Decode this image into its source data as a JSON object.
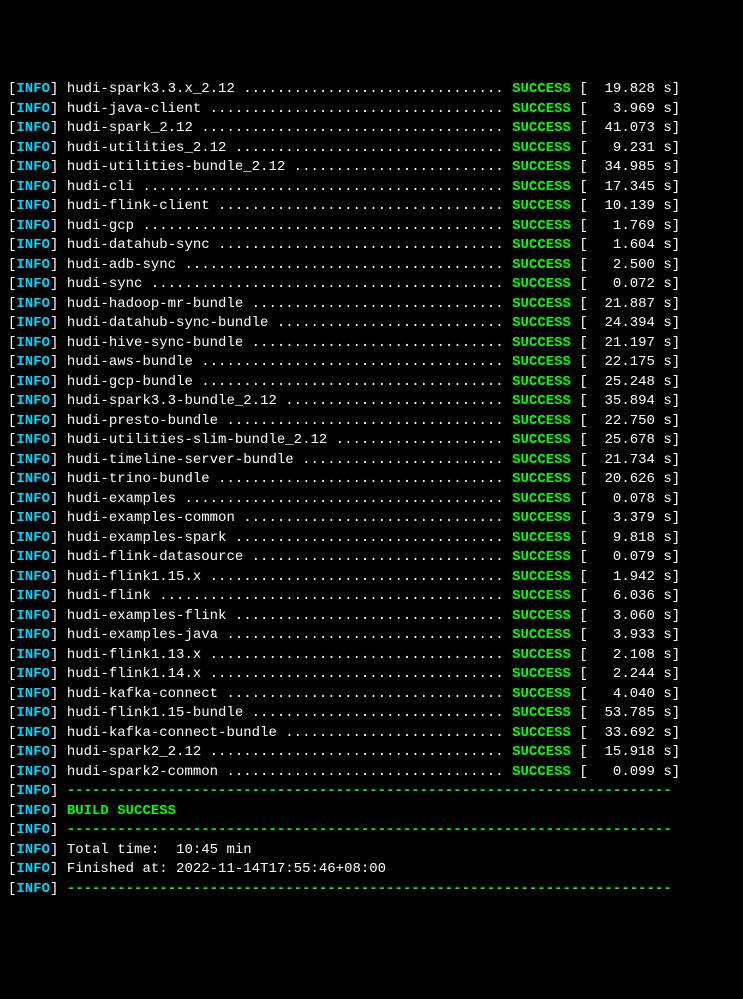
{
  "prefix": "INFO",
  "modules": [
    {
      "name": "hudi-spark3.3.x_2.12",
      "status": "SUCCESS",
      "time": "19.828"
    },
    {
      "name": "hudi-java-client",
      "status": "SUCCESS",
      "time": "3.969"
    },
    {
      "name": "hudi-spark_2.12",
      "status": "SUCCESS",
      "time": "41.073"
    },
    {
      "name": "hudi-utilities_2.12",
      "status": "SUCCESS",
      "time": "9.231"
    },
    {
      "name": "hudi-utilities-bundle_2.12",
      "status": "SUCCESS",
      "time": "34.985"
    },
    {
      "name": "hudi-cli",
      "status": "SUCCESS",
      "time": "17.345"
    },
    {
      "name": "hudi-flink-client",
      "status": "SUCCESS",
      "time": "10.139"
    },
    {
      "name": "hudi-gcp",
      "status": "SUCCESS",
      "time": "1.769"
    },
    {
      "name": "hudi-datahub-sync",
      "status": "SUCCESS",
      "time": "1.604"
    },
    {
      "name": "hudi-adb-sync",
      "status": "SUCCESS",
      "time": "2.500"
    },
    {
      "name": "hudi-sync",
      "status": "SUCCESS",
      "time": "0.072"
    },
    {
      "name": "hudi-hadoop-mr-bundle",
      "status": "SUCCESS",
      "time": "21.887"
    },
    {
      "name": "hudi-datahub-sync-bundle",
      "status": "SUCCESS",
      "time": "24.394"
    },
    {
      "name": "hudi-hive-sync-bundle",
      "status": "SUCCESS",
      "time": "21.197"
    },
    {
      "name": "hudi-aws-bundle",
      "status": "SUCCESS",
      "time": "22.175"
    },
    {
      "name": "hudi-gcp-bundle",
      "status": "SUCCESS",
      "time": "25.248"
    },
    {
      "name": "hudi-spark3.3-bundle_2.12",
      "status": "SUCCESS",
      "time": "35.894"
    },
    {
      "name": "hudi-presto-bundle",
      "status": "SUCCESS",
      "time": "22.750"
    },
    {
      "name": "hudi-utilities-slim-bundle_2.12",
      "status": "SUCCESS",
      "time": "25.678"
    },
    {
      "name": "hudi-timeline-server-bundle",
      "status": "SUCCESS",
      "time": "21.734"
    },
    {
      "name": "hudi-trino-bundle",
      "status": "SUCCESS",
      "time": "20.626"
    },
    {
      "name": "hudi-examples",
      "status": "SUCCESS",
      "time": "0.078"
    },
    {
      "name": "hudi-examples-common",
      "status": "SUCCESS",
      "time": "3.379"
    },
    {
      "name": "hudi-examples-spark",
      "status": "SUCCESS",
      "time": "9.818"
    },
    {
      "name": "hudi-flink-datasource",
      "status": "SUCCESS",
      "time": "0.079"
    },
    {
      "name": "hudi-flink1.15.x",
      "status": "SUCCESS",
      "time": "1.942"
    },
    {
      "name": "hudi-flink",
      "status": "SUCCESS",
      "time": "6.036"
    },
    {
      "name": "hudi-examples-flink",
      "status": "SUCCESS",
      "time": "3.060"
    },
    {
      "name": "hudi-examples-java",
      "status": "SUCCESS",
      "time": "3.933"
    },
    {
      "name": "hudi-flink1.13.x",
      "status": "SUCCESS",
      "time": "2.108"
    },
    {
      "name": "hudi-flink1.14.x",
      "status": "SUCCESS",
      "time": "2.244"
    },
    {
      "name": "hudi-kafka-connect",
      "status": "SUCCESS",
      "time": "4.040"
    },
    {
      "name": "hudi-flink1.15-bundle",
      "status": "SUCCESS",
      "time": "53.785"
    },
    {
      "name": "hudi-kafka-connect-bundle",
      "status": "SUCCESS",
      "time": "33.692"
    },
    {
      "name": "hudi-spark2_2.12",
      "status": "SUCCESS",
      "time": "15.918"
    },
    {
      "name": "hudi-spark2-common",
      "status": "SUCCESS",
      "time": "0.099"
    }
  ],
  "separator": "------------------------------------------------------------------------",
  "build_status": "BUILD SUCCESS",
  "total_time_label": "Total time:  ",
  "total_time_value": "10:45 min",
  "finished_label": "Finished at: ",
  "finished_value": "2022-11-14T17:55:46+08:00"
}
